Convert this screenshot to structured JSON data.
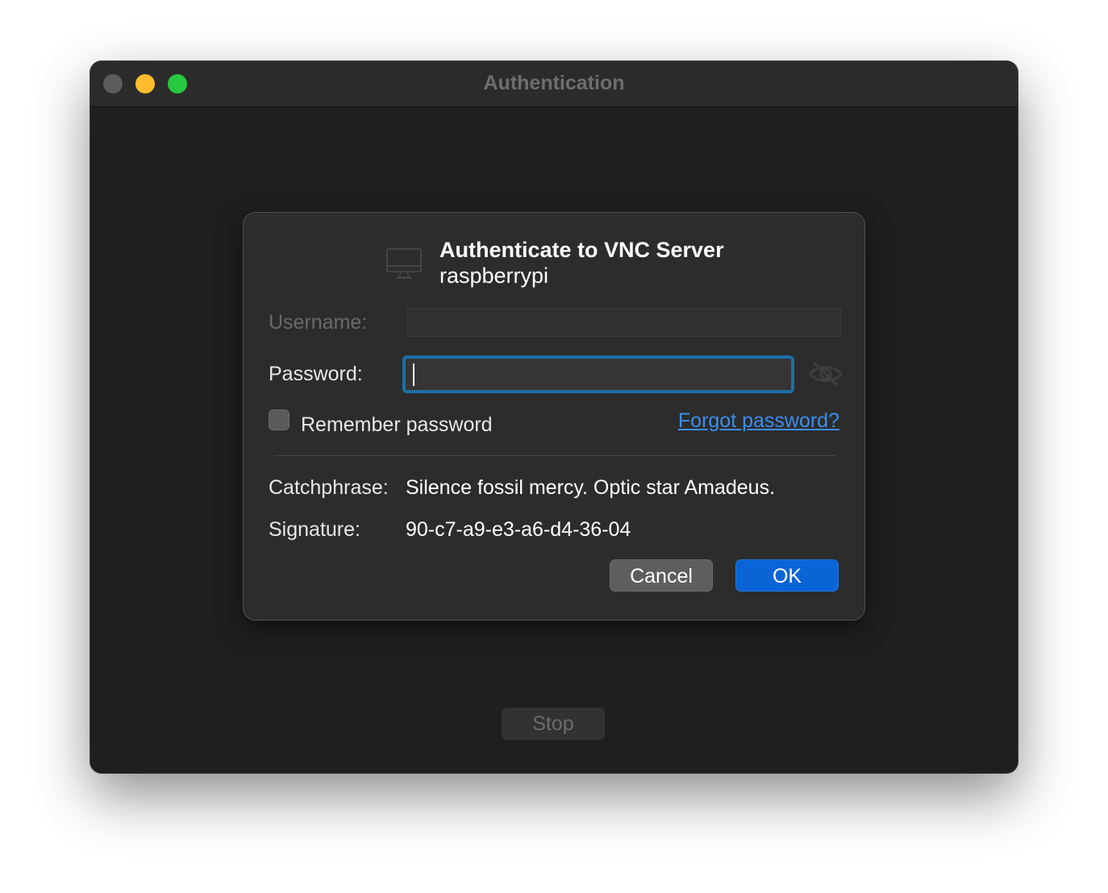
{
  "window": {
    "title": "Authentication"
  },
  "dialog": {
    "title": "Authenticate to VNC Server",
    "host": "raspberrypi",
    "username_label": "Username:",
    "username_value": "",
    "password_label": "Password:",
    "password_value": "",
    "remember_label": "Remember password",
    "remember_checked": false,
    "forgot_link": "Forgot password?",
    "catchphrase_label": "Catchphrase:",
    "catchphrase_value": "Silence fossil mercy. Optic star Amadeus.",
    "signature_label": "Signature:",
    "signature_value": "90-c7-a9-e3-a6-d4-36-04",
    "cancel_label": "Cancel",
    "ok_label": "OK"
  },
  "footer": {
    "stop_label": "Stop"
  },
  "icons": {
    "server": "monitor-icon",
    "reveal": "eye-slash-icon"
  },
  "colors": {
    "accent": "#0a64d6",
    "link": "#3d8ef0",
    "focus_ring": "#1e6fa8",
    "close": "#5c5c5c",
    "minimize": "#febc2e",
    "maximize": "#28c840"
  }
}
